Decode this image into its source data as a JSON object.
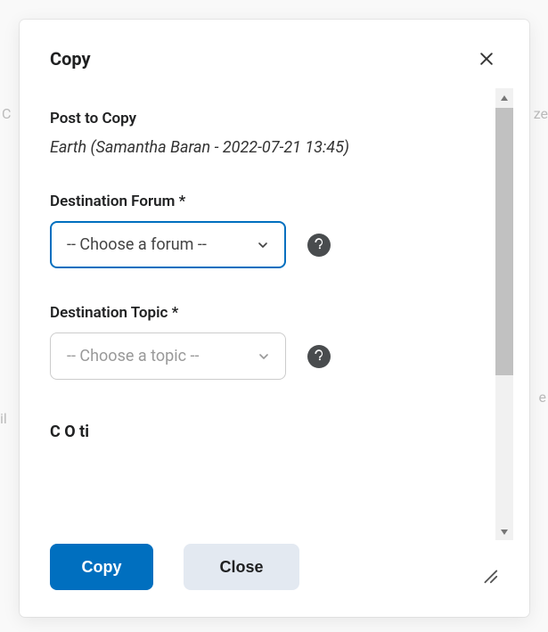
{
  "modal": {
    "title": "Copy",
    "post_to_copy_label": "Post to Copy",
    "post_to_copy_value": "Earth (Samantha Baran - 2022-07-21 13:45)",
    "destination_forum_label": "Destination Forum *",
    "destination_forum_value": "-- Choose a forum --",
    "destination_topic_label": "Destination Topic *",
    "destination_topic_value": "-- Choose a topic --",
    "cutoff_heading_visible": "C         O   ti",
    "buttons": {
      "copy": "Copy",
      "close": "Close"
    }
  },
  "bg": {
    "left1": "C",
    "left2": "il",
    "right1": "ze",
    "right2": "e"
  }
}
